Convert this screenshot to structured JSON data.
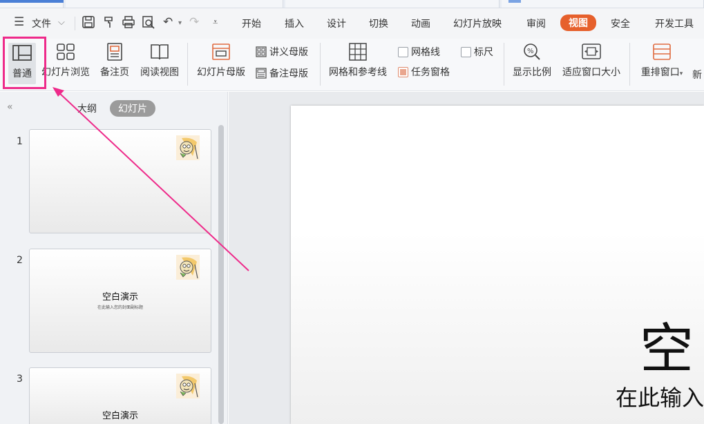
{
  "menubar": {
    "file_menu": "文件",
    "tabs": [
      "开始",
      "插入",
      "设计",
      "切换",
      "动画",
      "幻灯片放映",
      "审阅",
      "视图",
      "安全",
      "开发工具"
    ],
    "active_tab": "视图"
  },
  "ribbon": {
    "normal": "普通",
    "slide_sorter": "幻灯片浏览",
    "notes_page": "备注页",
    "reading_view": "阅读视图",
    "slide_master": "幻灯片母版",
    "handout_master": "讲义母版",
    "notes_master": "备注母版",
    "grid_guides": "网格和参考线",
    "gridlines": "网格线",
    "ruler": "标尺",
    "task_pane": "任务窗格",
    "zoom": "显示比例",
    "fit_window": "适应窗口大小",
    "rearrange": "重排窗口",
    "new_cut": "新"
  },
  "panel": {
    "tab_outline": "大纲",
    "tab_slides": "幻灯片",
    "slides": [
      {
        "num": "1",
        "title": "",
        "subtitle": ""
      },
      {
        "num": "2",
        "title": "空白演示",
        "subtitle": "在此输入您的封面副标题"
      },
      {
        "num": "3",
        "title": "空白演示",
        "subtitle": ""
      }
    ]
  },
  "canvas": {
    "title": "空",
    "subtitle": "在此输入"
  },
  "colors": {
    "accent": "#e6602c",
    "highlight": "#ee2a8a"
  }
}
